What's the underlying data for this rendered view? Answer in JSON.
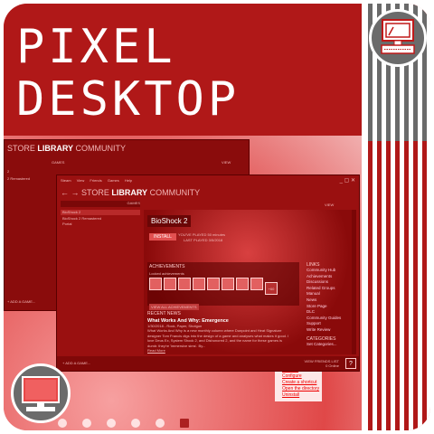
{
  "title": {
    "line1": "PIXEL",
    "line2": "DESKTOP"
  },
  "colors": {
    "primary": "#b01818",
    "gray": "#6b6b6b",
    "white": "#ffffff"
  },
  "back_window": {
    "nav": {
      "store": "STORE",
      "library": "LIBRARY",
      "community": "COMMUNITY"
    },
    "games_label": "GAMES",
    "view_label": "VIEW",
    "list": [
      "2",
      "2 Remastered"
    ],
    "add_game": "+ ADD A GAME..."
  },
  "front_window": {
    "menu": [
      "Steam",
      "View",
      "Friends",
      "Games",
      "Help"
    ],
    "nav": {
      "store": "STORE",
      "library": "LIBRARY",
      "community": "COMMUNITY"
    },
    "search_placeholder": "Search",
    "games_label": "GAMES",
    "view_label": "VIEW",
    "games": [
      "BioShock 2",
      "BioShock 2 Remastered",
      "Portal"
    ],
    "game_title": "BioShock 2",
    "install_label": "INSTALL",
    "played": "YOU'VE PLAYED 50 minutes",
    "last_played": "LAST PLAYED 3/5/2018",
    "achievements": {
      "heading": "ACHIEVEMENTS",
      "sub": "Locked achievements",
      "more": "+60",
      "view_all": "VIEW ALL ACHIEVEMENTS"
    },
    "news": {
      "heading": "RECENT NEWS",
      "title": "What Works And Why: Emergence",
      "meta": "1/30/2018 - Rock, Paper, Shotgun",
      "body": "What Works And Why is a new monthly column where Dunpoint and Heat Signature designer Tom Francis digs into the design of a game and analyses what makes it good. I love Deus Ex, System Shock 2, and Dishonored 2, and the name for these games is dumb: they're 'immersive sims'. By...",
      "read_more": "Read More"
    },
    "links": {
      "heading": "LINKS",
      "items": [
        "Community Hub",
        "Achievements",
        "Discussions",
        "Related Groups",
        "Manual",
        "News",
        "Store Page",
        "DLC",
        "Community Guides",
        "Support",
        "Write Review"
      ]
    },
    "categories": {
      "heading": "CATEGORIES",
      "set": "Set Categories..."
    },
    "add_game": "+ ADD A GAME...",
    "friends": "VIEW FRIENDS LIST",
    "online": "0 Online",
    "help": "?"
  },
  "context_menu": [
    "Settings",
    "Configure",
    "Create a shortcut",
    "Open the directory",
    "Uninstall"
  ],
  "icons": {
    "top_right": "computer-icon",
    "bottom_left": "monitor-icon"
  }
}
